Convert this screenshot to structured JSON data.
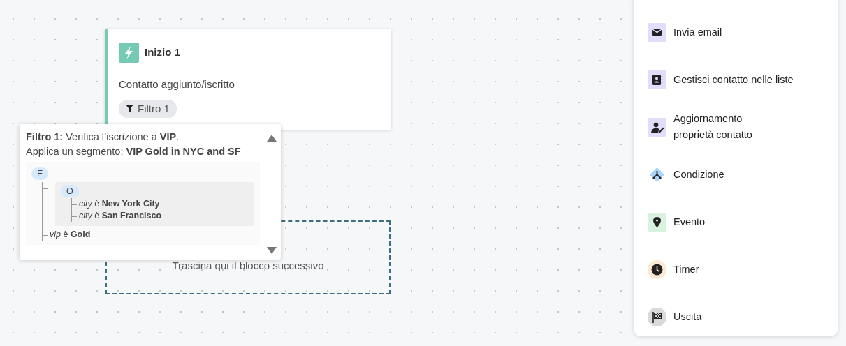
{
  "start_node": {
    "title": "Inizio 1",
    "trigger": "Contatto aggiunto/iscritto",
    "filter_tag": "Filtro 1"
  },
  "filter_popover": {
    "lines": [
      "**Filtro 1:** Verifica l’iscrizione a **VIP**.",
      "Applica un segmento: **VIP Gold in NYC and SF**"
    ],
    "tree": {
      "operator": "E",
      "children": [
        {
          "kind": "group",
          "operator": "O",
          "children": [
            {
              "kind": "condition",
              "text": "*city* è **New York City**"
            },
            {
              "kind": "condition",
              "text": "*city* è **San Francisco**"
            }
          ]
        },
        {
          "kind": "condition",
          "text": "*vip* è **Gold**"
        }
      ]
    }
  },
  "drop_zone": {
    "text": "Trascina qui il blocco successivo"
  },
  "blocks_panel": {
    "items": [
      {
        "kind": "email",
        "label": "Invia email",
        "color": "#e3dcfc"
      },
      {
        "kind": "contacts",
        "label": "Gestisci contatto nelle liste",
        "color": "#e3dcfc"
      },
      {
        "kind": "person-edit",
        "label": "Aggiornamento\nproprietà contatto",
        "color": "#e3dcfc"
      },
      {
        "kind": "condition",
        "label": "Condizione",
        "color": "#a9d4fb"
      },
      {
        "kind": "event",
        "label": "Evento",
        "color": "#d9f2df"
      },
      {
        "kind": "timer",
        "label": "Timer",
        "color": "#fde9d3"
      },
      {
        "kind": "exit",
        "label": "Uscita",
        "color": "#dadada"
      }
    ]
  }
}
